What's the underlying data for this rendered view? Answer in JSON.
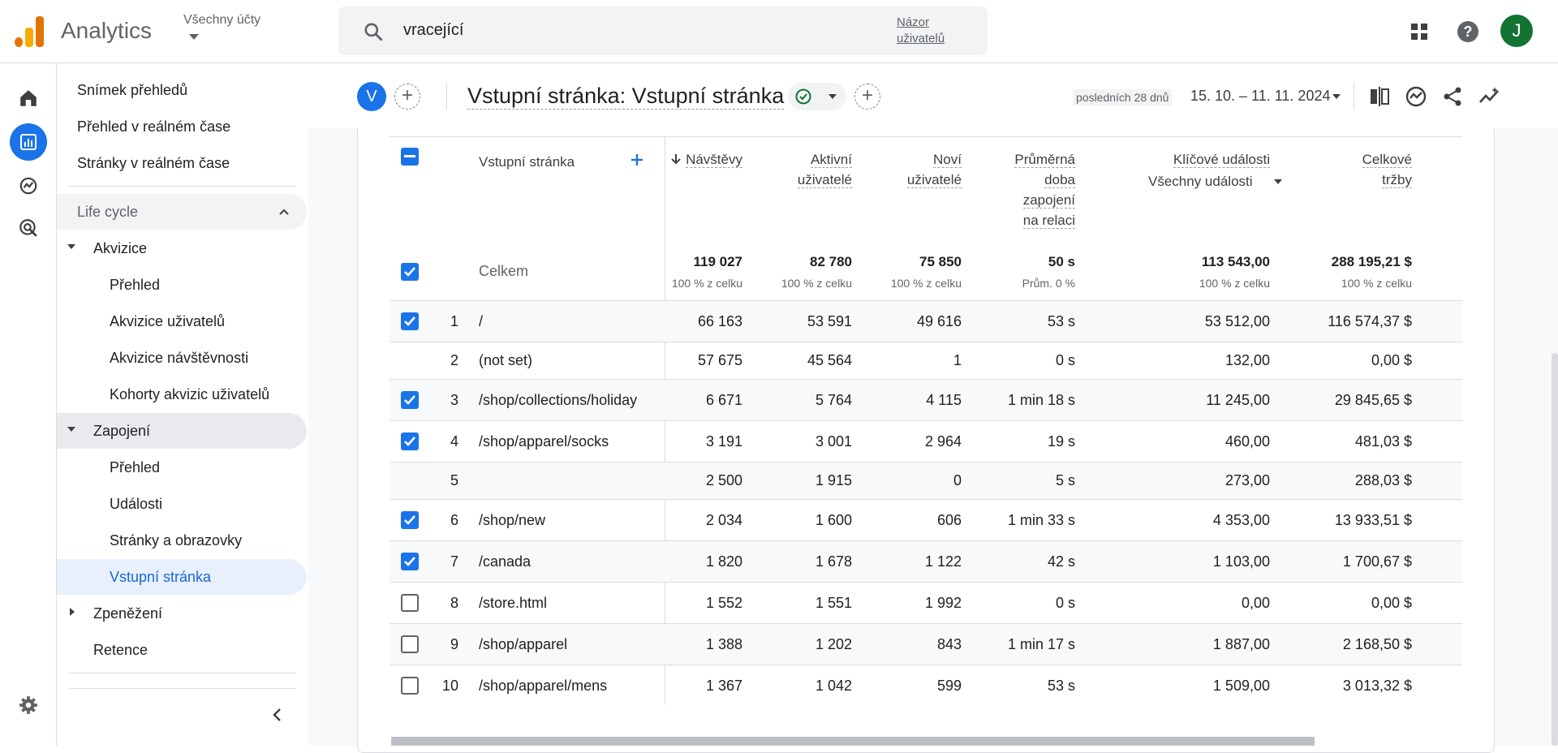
{
  "topbar": {
    "app_name": "Analytics",
    "account_label": "Všechny účty",
    "search_query": "vracející",
    "search_link": "Názor uživatelů",
    "avatar_initial": "J"
  },
  "sidebar": {
    "items": [
      {
        "label": "Snímek přehledů"
      },
      {
        "label": "Přehled v reálném čase"
      },
      {
        "label": "Stránky v reálném čase"
      }
    ],
    "section": "Life cycle",
    "groups": {
      "akvizice": {
        "label": "Akvizice",
        "children": [
          "Přehled",
          "Akvizice uživatelů",
          "Akvizice návštěvnosti",
          "Kohorty akvizic uživatelů"
        ]
      },
      "zapojeni": {
        "label": "Zapojení",
        "children": [
          "Přehled",
          "Události",
          "Stránky a obrazovky",
          "Vstupní stránka"
        ]
      },
      "zpenezeni": {
        "label": "Zpeněžení"
      },
      "retence": {
        "label": "Retence"
      }
    }
  },
  "header": {
    "segment_badge": "V",
    "title": "Vstupní stránka: Vstupní stránka",
    "date_label": "posledních 28 dnů",
    "date_range": "15. 10. – 11. 11. 2024"
  },
  "table": {
    "dimension_header": "Vstupní stránka",
    "columns": {
      "navstevy": "Návštěvy",
      "aktivni_1": "Aktivní",
      "aktivni_2": "uživatelé",
      "novi_1": "Noví",
      "novi_2": "uživatelé",
      "prumer_1": "Průměrná",
      "prumer_2": "doba",
      "prumer_3": "zapojení",
      "prumer_4": "na relaci",
      "klicove": "Klíčové události",
      "klicove_filter": "Všechny události",
      "trzby_1": "Celkové",
      "trzby_2": "tržby"
    },
    "totals": {
      "label": "Celkem",
      "navstevy": "119 027",
      "navstevy_sub": "100 % z celku",
      "aktivni": "82 780",
      "aktivni_sub": "100 % z celku",
      "novi": "75 850",
      "novi_sub": "100 % z celku",
      "prumer": "50 s",
      "prumer_sub": "Prům. 0 %",
      "klicove": "113 543,00",
      "klicove_sub": "100 % z celku",
      "trzby": "288 195,21 $",
      "trzby_sub": "100 % z celku"
    },
    "rows": [
      {
        "idx": "1",
        "page": "/",
        "navstevy": "66 163",
        "aktivni": "53 591",
        "novi": "49 616",
        "prumer": "53 s",
        "klicove": "53 512,00",
        "trzby": "116 574,37 $"
      },
      {
        "idx": "2",
        "page": "(not set)",
        "navstevy": "57 675",
        "aktivni": "45 564",
        "novi": "1",
        "prumer": "0 s",
        "klicove": "132,00",
        "trzby": "0,00 $"
      },
      {
        "idx": "3",
        "page": "/shop/collections/holiday",
        "navstevy": "6 671",
        "aktivni": "5 764",
        "novi": "4 115",
        "prumer": "1 min 18 s",
        "klicove": "11 245,00",
        "trzby": "29 845,65 $"
      },
      {
        "idx": "4",
        "page": "/shop/apparel/socks",
        "navstevy": "3 191",
        "aktivni": "3 001",
        "novi": "2 964",
        "prumer": "19 s",
        "klicove": "460,00",
        "trzby": "481,03 $"
      },
      {
        "idx": "5",
        "page": "",
        "navstevy": "2 500",
        "aktivni": "1 915",
        "novi": "0",
        "prumer": "5 s",
        "klicove": "273,00",
        "trzby": "288,03 $"
      },
      {
        "idx": "6",
        "page": "/shop/new",
        "navstevy": "2 034",
        "aktivni": "1 600",
        "novi": "606",
        "prumer": "1 min 33 s",
        "klicove": "4 353,00",
        "trzby": "13 933,51 $"
      },
      {
        "idx": "7",
        "page": "/canada",
        "navstevy": "1 820",
        "aktivni": "1 678",
        "novi": "1 122",
        "prumer": "42 s",
        "klicove": "1 103,00",
        "trzby": "1 700,67 $"
      },
      {
        "idx": "8",
        "page": "/store.html",
        "navstevy": "1 552",
        "aktivni": "1 551",
        "novi": "1 992",
        "prumer": "0 s",
        "klicove": "0,00",
        "trzby": "0,00 $"
      },
      {
        "idx": "9",
        "page": "/shop/apparel",
        "navstevy": "1 388",
        "aktivni": "1 202",
        "novi": "843",
        "prumer": "1 min 17 s",
        "klicove": "1 887,00",
        "trzby": "2 168,50 $"
      },
      {
        "idx": "10",
        "page": "/shop/apparel/mens",
        "navstevy": "1 367",
        "aktivni": "1 042",
        "novi": "599",
        "prumer": "53 s",
        "klicove": "1 509,00",
        "trzby": "3 013,32 $"
      }
    ]
  },
  "colors": {
    "accent": "#1a73e8",
    "active_bg": "#e8f0fe",
    "hover_bg": "#e8eaed",
    "avatar": "#137333"
  }
}
